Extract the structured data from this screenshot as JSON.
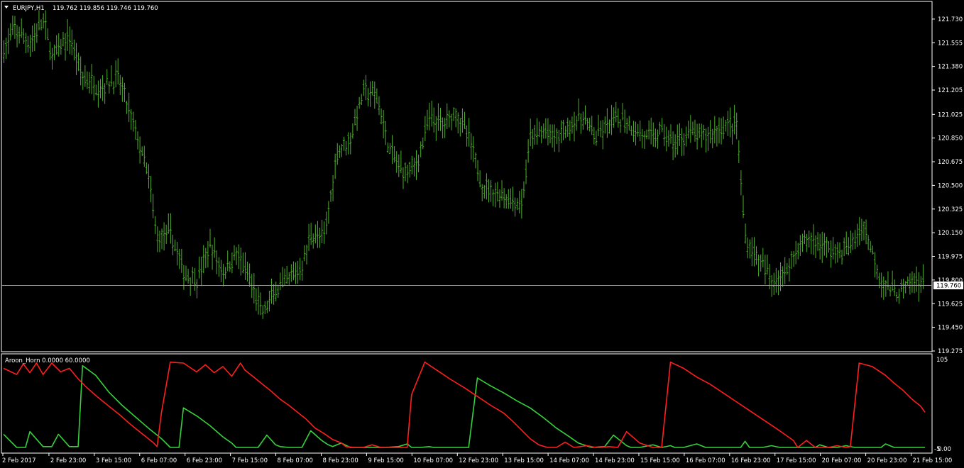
{
  "main_panel": {
    "header_arrow": "down-triangle-icon",
    "symbol": "EURJPY,H1",
    "ohlc": "119.762 119.856 119.746 119.760",
    "price_labels": [
      "121.730",
      "121.555",
      "121.380",
      "121.205",
      "121.025",
      "120.850",
      "120.675",
      "120.500",
      "120.325",
      "120.150",
      "119.975",
      "119.800",
      "119.625",
      "119.450",
      "119.275"
    ],
    "current_price": "119.760"
  },
  "indicator_panel": {
    "title": "Aroon_Horn 0.0000 60.0000",
    "scale_top": "105",
    "scale_bottom": "-5",
    "scale_bottom_overlap": "0.00"
  },
  "time_labels": [
    "2 Feb 2017",
    "2 Feb 23:00",
    "3 Feb 15:00",
    "6 Feb 07:00",
    "6 Feb 23:00",
    "7 Feb 15:00",
    "8 Feb 07:00",
    "8 Feb 23:00",
    "9 Feb 15:00",
    "10 Feb 07:00",
    "12 Feb 23:00",
    "13 Feb 15:00",
    "14 Feb 07:00",
    "14 Feb 23:00",
    "15 Feb 15:00",
    "16 Feb 07:00",
    "16 Feb 23:00",
    "17 Feb 15:00",
    "20 Feb 07:00",
    "20 Feb 23:00",
    "21 Feb 15:00"
  ],
  "colors": {
    "background": "#000000",
    "border": "#ffffff",
    "bars": "#4caf28",
    "price_line": "#a0a0a0",
    "aroon_up": "#36d13c",
    "aroon_down": "#ff1e1e"
  },
  "chart_data": [
    {
      "type": "ohlc",
      "x_unit": "hour",
      "ylim": [
        119.275,
        121.85
      ],
      "price_anchors": [
        [
          0,
          121.5
        ],
        [
          5,
          121.65
        ],
        [
          12,
          121.55
        ],
        [
          18,
          121.72
        ],
        [
          22,
          121.45
        ],
        [
          30,
          121.6
        ],
        [
          36,
          121.3
        ],
        [
          44,
          121.22
        ],
        [
          52,
          121.3
        ],
        [
          60,
          120.9
        ],
        [
          66,
          120.55
        ],
        [
          70,
          120.1
        ],
        [
          76,
          120.15
        ],
        [
          82,
          119.85
        ],
        [
          88,
          119.8
        ],
        [
          94,
          120.05
        ],
        [
          100,
          119.85
        ],
        [
          106,
          120.0
        ],
        [
          112,
          119.8
        ],
        [
          118,
          119.55
        ],
        [
          124,
          119.72
        ],
        [
          130,
          119.8
        ],
        [
          136,
          119.9
        ],
        [
          140,
          120.15
        ],
        [
          146,
          120.1
        ],
        [
          152,
          120.75
        ],
        [
          158,
          120.85
        ],
        [
          164,
          121.2
        ],
        [
          170,
          121.15
        ],
        [
          176,
          120.75
        ],
        [
          182,
          120.6
        ],
        [
          188,
          120.65
        ],
        [
          194,
          121.0
        ],
        [
          200,
          120.95
        ],
        [
          206,
          121.05
        ],
        [
          212,
          120.85
        ],
        [
          218,
          120.5
        ],
        [
          224,
          120.45
        ],
        [
          230,
          120.4
        ],
        [
          236,
          120.35
        ],
        [
          240,
          120.85
        ],
        [
          246,
          120.9
        ],
        [
          252,
          120.85
        ],
        [
          258,
          120.95
        ],
        [
          264,
          121.0
        ],
        [
          270,
          120.85
        ],
        [
          276,
          120.95
        ],
        [
          282,
          121.0
        ],
        [
          288,
          120.9
        ],
        [
          294,
          120.85
        ],
        [
          300,
          120.9
        ],
        [
          306,
          120.8
        ],
        [
          312,
          120.9
        ],
        [
          318,
          120.85
        ],
        [
          324,
          120.9
        ],
        [
          330,
          120.95
        ],
        [
          334,
          120.95
        ],
        [
          338,
          120.1
        ],
        [
          344,
          119.95
        ],
        [
          350,
          119.8
        ],
        [
          356,
          119.85
        ],
        [
          362,
          120.05
        ],
        [
          368,
          120.1
        ],
        [
          374,
          120.05
        ],
        [
          380,
          120.0
        ],
        [
          386,
          120.05
        ],
        [
          392,
          120.2
        ],
        [
          396,
          120.0
        ],
        [
          400,
          119.8
        ],
        [
          406,
          119.7
        ],
        [
          412,
          119.75
        ],
        [
          416,
          119.8
        ],
        [
          420,
          119.76
        ]
      ],
      "bar_count": 420
    },
    {
      "type": "line",
      "title": "Aroon_Horn 0.0000 60.0000",
      "ylim": [
        -5,
        105
      ],
      "series": [
        {
          "color": "#36d13c",
          "points": [
            [
              0,
              15
            ],
            [
              6,
              0
            ],
            [
              10,
              0
            ],
            [
              12,
              18
            ],
            [
              18,
              1
            ],
            [
              22,
              1
            ],
            [
              25,
              15
            ],
            [
              30,
              1
            ],
            [
              34,
              1
            ],
            [
              36,
              93
            ],
            [
              42,
              82
            ],
            [
              48,
              63
            ],
            [
              54,
              48
            ],
            [
              60,
              35
            ],
            [
              66,
              22
            ],
            [
              72,
              10
            ],
            [
              76,
              0
            ],
            [
              80,
              0
            ],
            [
              82,
              45
            ],
            [
              88,
              36
            ],
            [
              94,
              25
            ],
            [
              100,
              12
            ],
            [
              104,
              5
            ],
            [
              106,
              0
            ],
            [
              110,
              0
            ],
            [
              116,
              0
            ],
            [
              120,
              14
            ],
            [
              124,
              3
            ],
            [
              126,
              1
            ],
            [
              130,
              0
            ],
            [
              136,
              0
            ],
            [
              140,
              19
            ],
            [
              145,
              8
            ],
            [
              148,
              3
            ],
            [
              150,
              1
            ],
            [
              154,
              5
            ],
            [
              158,
              0
            ],
            [
              160,
              0
            ],
            [
              166,
              0
            ],
            [
              170,
              0
            ],
            [
              174,
              0
            ],
            [
              180,
              1
            ],
            [
              184,
              4
            ],
            [
              186,
              0
            ],
            [
              190,
              0
            ],
            [
              194,
              1
            ],
            [
              196,
              0
            ],
            [
              200,
              0
            ],
            [
              206,
              0
            ],
            [
              208,
              0
            ],
            [
              212,
              0
            ],
            [
              216,
              79
            ],
            [
              222,
              70
            ],
            [
              228,
              62
            ],
            [
              234,
              53
            ],
            [
              240,
              45
            ],
            [
              246,
              34
            ],
            [
              252,
              22
            ],
            [
              258,
              12
            ],
            [
              262,
              5
            ],
            [
              268,
              0
            ],
            [
              274,
              1
            ],
            [
              278,
              14
            ],
            [
              284,
              2
            ],
            [
              286,
              0
            ],
            [
              290,
              0
            ],
            [
              296,
              3
            ],
            [
              300,
              0
            ],
            [
              304,
              2
            ],
            [
              306,
              0
            ],
            [
              310,
              0
            ],
            [
              316,
              4
            ],
            [
              320,
              0
            ],
            [
              324,
              0
            ],
            [
              330,
              0
            ],
            [
              336,
              0
            ],
            [
              338,
              7
            ],
            [
              340,
              0
            ],
            [
              346,
              0
            ],
            [
              350,
              2
            ],
            [
              354,
              0
            ],
            [
              358,
              0
            ],
            [
              362,
              0
            ],
            [
              364,
              0
            ],
            [
              370,
              0
            ],
            [
              372,
              3
            ],
            [
              376,
              0
            ],
            [
              380,
              0
            ],
            [
              384,
              2
            ],
            [
              388,
              0
            ],
            [
              392,
              0
            ],
            [
              396,
              0
            ],
            [
              400,
              0
            ],
            [
              402,
              4
            ],
            [
              406,
              0
            ],
            [
              410,
              0
            ],
            [
              412,
              0
            ],
            [
              416,
              0
            ],
            [
              420,
              0
            ]
          ]
        },
        {
          "color": "#ff1e1e",
          "points": [
            [
              0,
              90
            ],
            [
              6,
              83
            ],
            [
              9,
              95
            ],
            [
              12,
              85
            ],
            [
              15,
              96
            ],
            [
              18,
              83
            ],
            [
              22,
              96
            ],
            [
              26,
              86
            ],
            [
              30,
              90
            ],
            [
              34,
              78
            ],
            [
              38,
              68
            ],
            [
              43,
              57
            ],
            [
              48,
              47
            ],
            [
              53,
              37
            ],
            [
              58,
              26
            ],
            [
              63,
              16
            ],
            [
              68,
              6
            ],
            [
              70,
              1
            ],
            [
              72,
              40
            ],
            [
              76,
              97
            ],
            [
              82,
              96
            ],
            [
              88,
              86
            ],
            [
              92,
              94
            ],
            [
              96,
              85
            ],
            [
              100,
              92
            ],
            [
              104,
              81
            ],
            [
              108,
              96
            ],
            [
              110,
              88
            ],
            [
              114,
              80
            ],
            [
              118,
              72
            ],
            [
              122,
              64
            ],
            [
              126,
              55
            ],
            [
              130,
              48
            ],
            [
              134,
              40
            ],
            [
              138,
              32
            ],
            [
              142,
              22
            ],
            [
              146,
              16
            ],
            [
              150,
              9
            ],
            [
              154,
              5
            ],
            [
              156,
              1
            ],
            [
              160,
              0
            ],
            [
              164,
              0
            ],
            [
              168,
              3
            ],
            [
              172,
              0
            ],
            [
              176,
              0
            ],
            [
              180,
              0
            ],
            [
              184,
              0
            ],
            [
              186,
              60
            ],
            [
              192,
              97
            ],
            [
              198,
              87
            ],
            [
              204,
              77
            ],
            [
              210,
              68
            ],
            [
              216,
              58
            ],
            [
              222,
              48
            ],
            [
              228,
              39
            ],
            [
              232,
              30
            ],
            [
              236,
              20
            ],
            [
              240,
              10
            ],
            [
              244,
              3
            ],
            [
              248,
              0
            ],
            [
              252,
              0
            ],
            [
              256,
              6
            ],
            [
              260,
              0
            ],
            [
              266,
              2
            ],
            [
              270,
              0
            ],
            [
              272,
              0
            ],
            [
              276,
              1
            ],
            [
              280,
              0
            ],
            [
              284,
              18
            ],
            [
              290,
              5
            ],
            [
              296,
              0
            ],
            [
              300,
              0
            ],
            [
              304,
              97
            ],
            [
              310,
              90
            ],
            [
              316,
              80
            ],
            [
              322,
              72
            ],
            [
              328,
              62
            ],
            [
              334,
              52
            ],
            [
              340,
              42
            ],
            [
              346,
              32
            ],
            [
              352,
              22
            ],
            [
              356,
              15
            ],
            [
              360,
              8
            ],
            [
              362,
              0
            ],
            [
              366,
              8
            ],
            [
              370,
              0
            ],
            [
              372,
              0
            ],
            [
              376,
              0
            ],
            [
              380,
              2
            ],
            [
              384,
              0
            ],
            [
              386,
              1
            ],
            [
              390,
              96
            ],
            [
              396,
              92
            ],
            [
              402,
              82
            ],
            [
              406,
              73
            ],
            [
              410,
              65
            ],
            [
              414,
              55
            ],
            [
              418,
              47
            ],
            [
              420,
              40
            ]
          ]
        }
      ]
    }
  ]
}
